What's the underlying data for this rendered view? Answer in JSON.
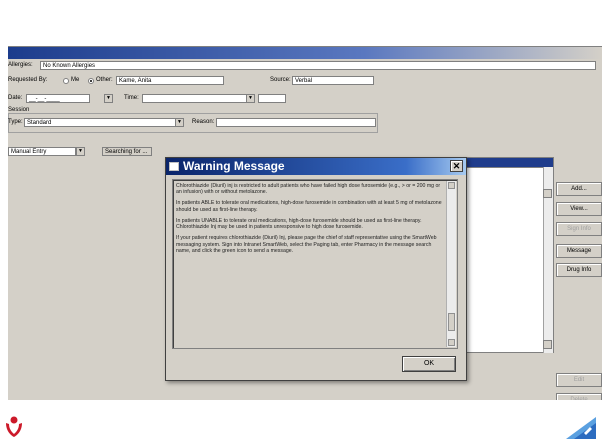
{
  "form": {
    "allergies_label": "Allergies:",
    "allergies_value": "No Known Allergies",
    "requested_by_label": "Requested By:",
    "radio_me": "Me",
    "radio_other": "Other:",
    "other_value": "Kame, Anita",
    "source_label": "Source:",
    "source_value": "Verbal",
    "date_label": "Date:",
    "date_value": "__-__-____",
    "time_label": "Time:",
    "session_label": "Session",
    "type_label": "Type:",
    "type_value": "Standard",
    "reason_label": "Reason:",
    "entry_value": "Manual Entry",
    "searching_label": "Searching for ..."
  },
  "side_buttons": [
    "Add...",
    "View...",
    "Sign Info",
    "Message",
    "Drug Info",
    "Edit",
    "Delete"
  ],
  "dialog": {
    "title": "Warning Message",
    "close_glyph": "✕",
    "paragraphs": [
      "Chlorothiazide (Diuril) inj is restricted to adult patients who have failed high dose furosemide (e.g., > or = 200 mg or an infusion) with or without metolazone.",
      "In patients ABLE to tolerate oral medications, high-dose furosemide in combination with at least 5 mg of metolazone should be used as first-line therapy.",
      "In patients UNABLE to tolerate oral medications, high-dose furosemide should be used as first-line therapy. Chlorothiazide Inj may be used in patients unresponsive to high dose furosemide.",
      "If your patient requires chlorothiazide (Diuril) Inj, please page the chief of staff representative using the SmartWeb messaging system. Sign into Intranet SmartWeb, select the Paging tab, enter Pharmacy in the message search name, and click the green icon to send a message."
    ],
    "ok_label": "OK"
  },
  "colors": {
    "title_bar": "#0a246a",
    "window_face": "#d4d0c8",
    "list_header_selected": "#1f3c8c"
  }
}
